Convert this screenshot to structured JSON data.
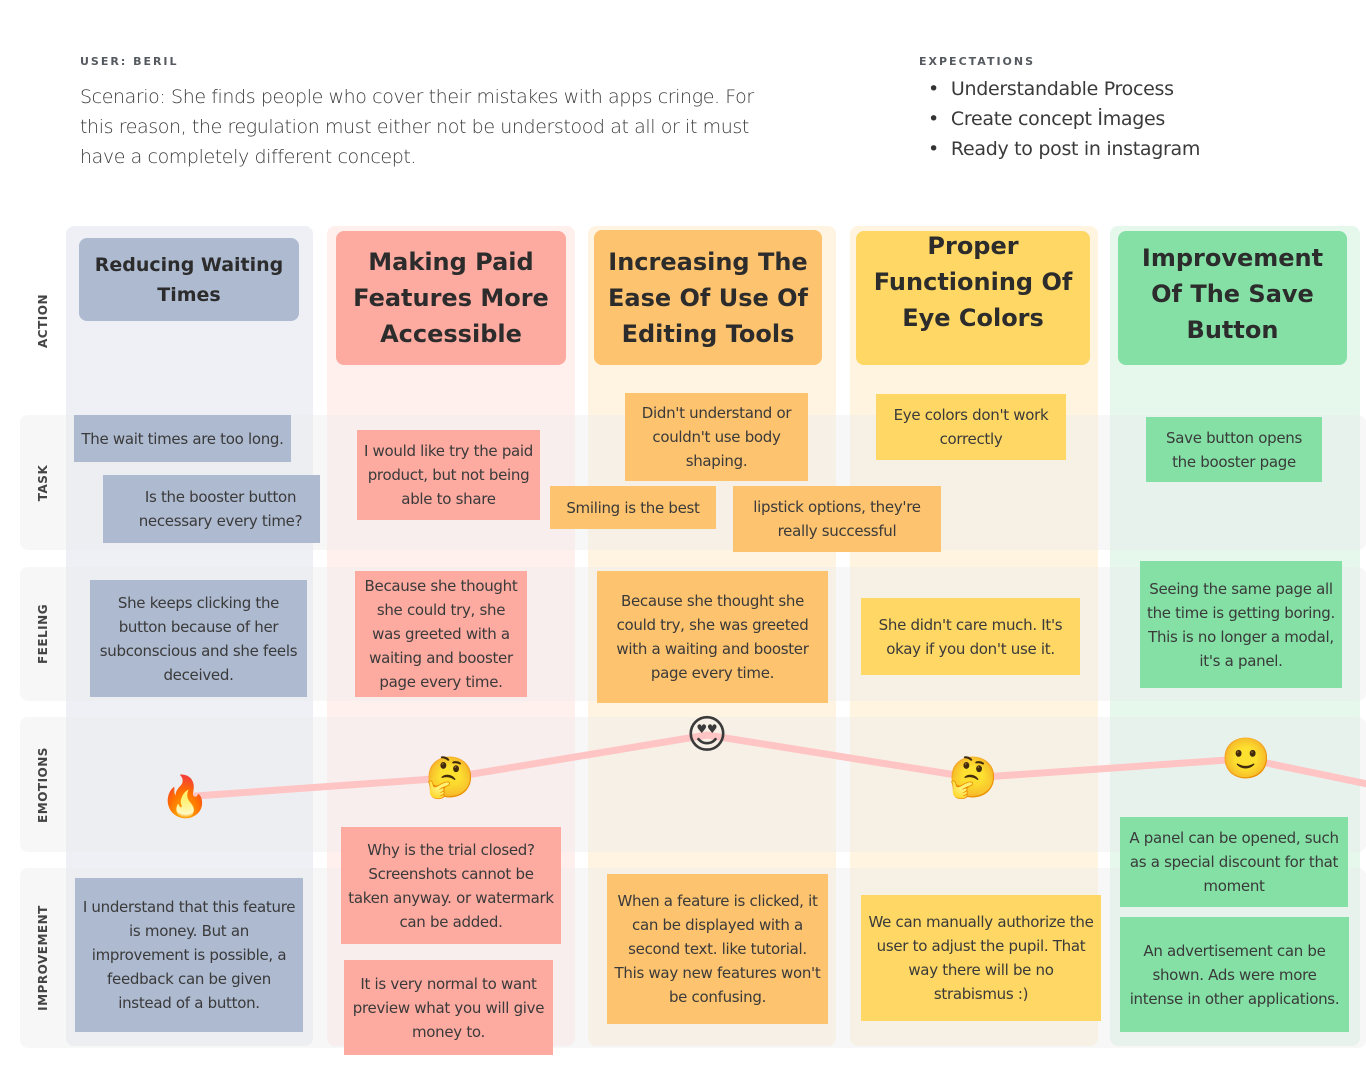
{
  "header": {
    "user_label": "USER: BERIL",
    "scenario": "Scenario: She finds people who cover their mistakes with apps cringe. For this reason, the regulation must either not be understood at all or it must have a completely different concept.",
    "expectations_label": "EXPECTATIONS",
    "expectations": [
      "Understandable Process",
      "Create concept İmages",
      "Ready to post in instagram"
    ]
  },
  "rows": {
    "action": "ACTION",
    "task": "TASK",
    "feeling": "FEELING",
    "emotions": "EMOTIONS",
    "improvement": "IMPROVEMENT"
  },
  "colors": {
    "blue": "#aebad0",
    "red": "#fdaba1",
    "orange": "#fdc36e",
    "yellow": "#fed764",
    "green": "#84e0a5",
    "emotion_line": "#ffc4c4"
  },
  "columns": [
    {
      "action": "Reducing Waiting Times",
      "tasks": [
        "The wait times are too long.",
        "Is the booster button necessary every time?"
      ],
      "feeling": "She keeps clicking the button because of her subconscious and she feels deceived.",
      "emotion": {
        "icon": "brain-on-fire-icon",
        "glyph": "🔥",
        "level": 0.35
      },
      "improvements": [
        "I understand that this feature is money. But an improvement is possible, a feedback can be given instead of a button."
      ]
    },
    {
      "action": "Making Paid Features More Accessible",
      "tasks": [
        "I would like try the paid product, but not being able to share"
      ],
      "feeling": "Because she thought she could try, she was greeted with a waiting and booster page every time.",
      "emotion": {
        "icon": "thinking-face-icon",
        "glyph": "🤔",
        "level": 0.55
      },
      "improvements": [
        "Why is the trial closed? Screenshots cannot be taken anyway. or watermark can be added.",
        "It is very normal to want preview what you will give money to."
      ]
    },
    {
      "action": "Increasing The Ease Of Use Of Editing Tools",
      "tasks": [
        "Didn't understand or couldn't use body shaping.",
        "Smiling is the best",
        "lipstick options, they're really successful"
      ],
      "feeling": "Because she thought she could try, she was greeted with a waiting and booster page every time.",
      "emotion": {
        "icon": "heart-eyes-face-icon",
        "glyph": "😍",
        "level": 1.0
      },
      "improvements": [
        "When a feature is clicked, it can be displayed with a second text. like tutorial. This way new features won't be confusing."
      ]
    },
    {
      "action": "Proper Functioning Of Eye Colors",
      "tasks": [
        "Eye colors don't work correctly"
      ],
      "feeling": "She didn't care much. It's okay if you don't use it.",
      "emotion": {
        "icon": "thinking-face-icon",
        "glyph": "🤔",
        "level": 0.55
      },
      "improvements": [
        "We can manually authorize the user to adjust the pupil. That way there will be no strabismus :)"
      ]
    },
    {
      "action": "Improvement Of The Save Button",
      "tasks": [
        "Save button opens the booster page"
      ],
      "feeling": "Seeing the same page all the time is getting boring. This is no longer a modal, it's a panel.",
      "emotion": {
        "icon": "slightly-smiling-face-icon",
        "glyph": "🙂",
        "level": 0.75
      },
      "improvements": [
        "A panel can be opened, such as a special discount for that moment",
        "An advertisement can be shown. Ads were more intense in other applications."
      ]
    }
  ]
}
